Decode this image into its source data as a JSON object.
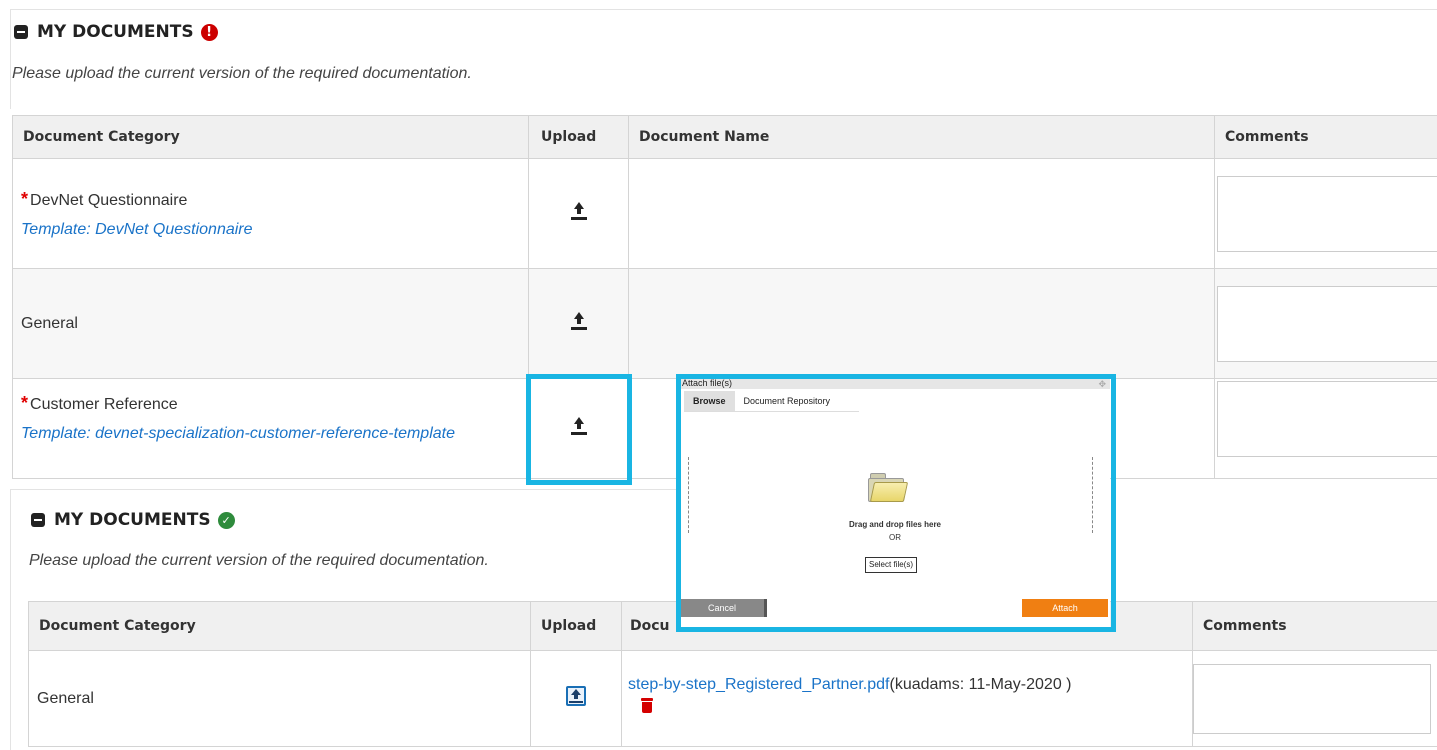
{
  "section1": {
    "title": "MY DOCUMENTS",
    "status_icon": "exclamation-icon",
    "instructions": "Please upload the current version of the required documentation.",
    "columns": [
      "Document Category",
      "Upload",
      "Document Name",
      "Comments"
    ],
    "rows": [
      {
        "required": true,
        "category": "DevNet Questionnaire",
        "template": "Template: DevNet Questionnaire"
      },
      {
        "required": false,
        "category": "General",
        "template": ""
      },
      {
        "required": true,
        "category": "Customer Reference",
        "template": "Template: devnet-specialization-customer-reference-template"
      }
    ]
  },
  "section2": {
    "title": "MY DOCUMENTS",
    "status_icon": "check-circle-icon",
    "instructions": "Please upload the current version of the required documentation.",
    "columns": [
      "Document Category",
      "Upload",
      "Document Name",
      "Comments"
    ],
    "columns_visible": [
      "Document Category",
      "Upload",
      "Docu",
      "Comments"
    ],
    "rows": [
      {
        "category": "General",
        "file_link": "step-by-step_Registered_Partner.pdf",
        "file_meta": "(kuadams: 11-May-2020 )"
      }
    ]
  },
  "dialog": {
    "title": "Attach file(s)",
    "tabs": [
      "Browse",
      "Document Repository"
    ],
    "active_tab": "Browse",
    "drop_text": "Drag and drop files here",
    "or_text": "OR",
    "select_label": "Select file(s)",
    "cancel_label": "Cancel",
    "attach_label": "Attach"
  },
  "colors": {
    "highlight": "#19b5e3",
    "link": "#1a73c8",
    "required": "#e00000",
    "attach": "#f07f12"
  }
}
